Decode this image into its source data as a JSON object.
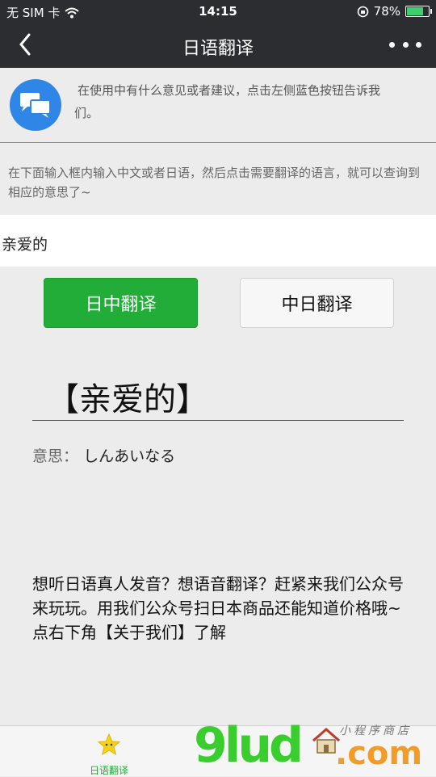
{
  "status_bar": {
    "carrier": "无 SIM 卡",
    "time": "14:15",
    "battery": "78%",
    "battery_level": 0.78
  },
  "nav": {
    "title": "日语翻译"
  },
  "feedback": {
    "text": "在使用中有什么意见或者建议，点击左侧蓝色按钮告诉我们。"
  },
  "instruction": "在下面输入框内输入中文或者日语，然后点击需要翻译的语言，就可以查询到相应的意思了~",
  "input": {
    "value": "亲爱的"
  },
  "buttons": {
    "jp_to_cn": "日中翻译",
    "cn_to_jp": "中日翻译"
  },
  "result": {
    "word": "【亲爱的】",
    "meaning_label": "意思：",
    "meaning_value": "しんあいなる"
  },
  "promo": "想听日语真人发音？想语音翻译？赶紧来我们公众号来玩玩。用我们公众号扫日本商品还能知道价格哦~ 点右下角【关于我们】了解",
  "tabbar": {
    "tab1_label": "日语翻译"
  },
  "watermark": {
    "logo": "9lud",
    "domain": ".com",
    "script": "小程序商店"
  },
  "colors": {
    "nav_bg": "#2c2d31",
    "green": "#22ad38",
    "blue": "#2f86e6"
  }
}
